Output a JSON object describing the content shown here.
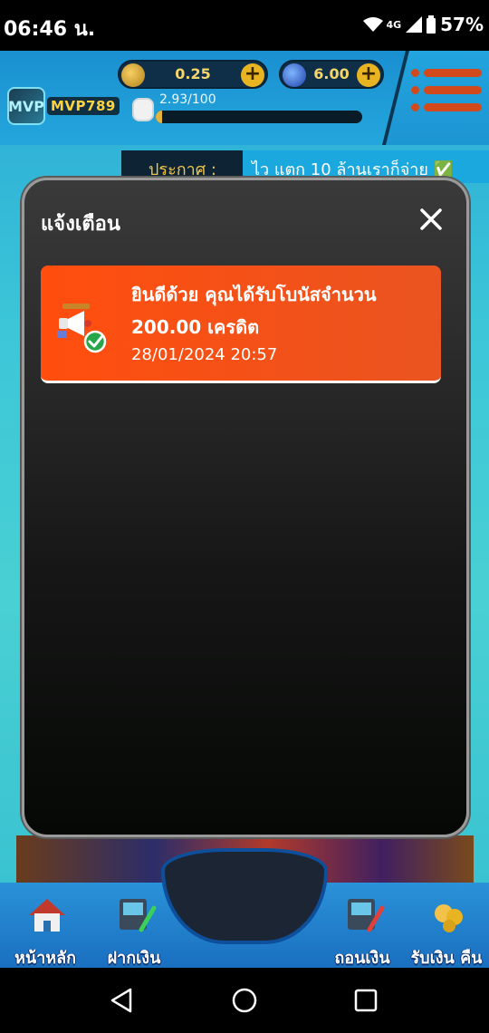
{
  "status_bar": {
    "time": "06:46 น.",
    "network": "4G",
    "battery": "57%"
  },
  "header": {
    "logo_text": "MVP789",
    "logo_mark": "MVP",
    "coins": "0.25",
    "gems": "6.00",
    "xp_text": "2.93/100",
    "xp_progress_fraction": 0.0293,
    "menu_icon": "hamburger-icon"
  },
  "announcement": {
    "label": "ประกาศ :",
    "text": "ไว แตก 10 ล้านเราก็จ่าย ✅"
  },
  "modal": {
    "title": "แจ้งเตือน",
    "close_icon": "close-icon",
    "notification": {
      "line1": "ยินดีด้วย คุณได้รับโบนัสจำนวน",
      "line2": "200.00 เครดิต",
      "datetime": "28/01/2024 20:57",
      "icon": "megaphone-check-icon"
    }
  },
  "bottom_nav": {
    "items": [
      {
        "label": "หน้าหลัก",
        "icon": "home-icon"
      },
      {
        "label": "ฝากเงิน",
        "icon": "deposit-icon"
      },
      {
        "label": "ถอนเงิน",
        "icon": "withdraw-icon"
      },
      {
        "label": "รับเงิน คืน",
        "icon": "cashback-icon"
      }
    ]
  },
  "colors": {
    "accent_orange": "#ff4e0e",
    "modal_bg": "#2c2c2c",
    "header_blue": "#1a8fd0",
    "coin_gold": "#e8b422"
  }
}
